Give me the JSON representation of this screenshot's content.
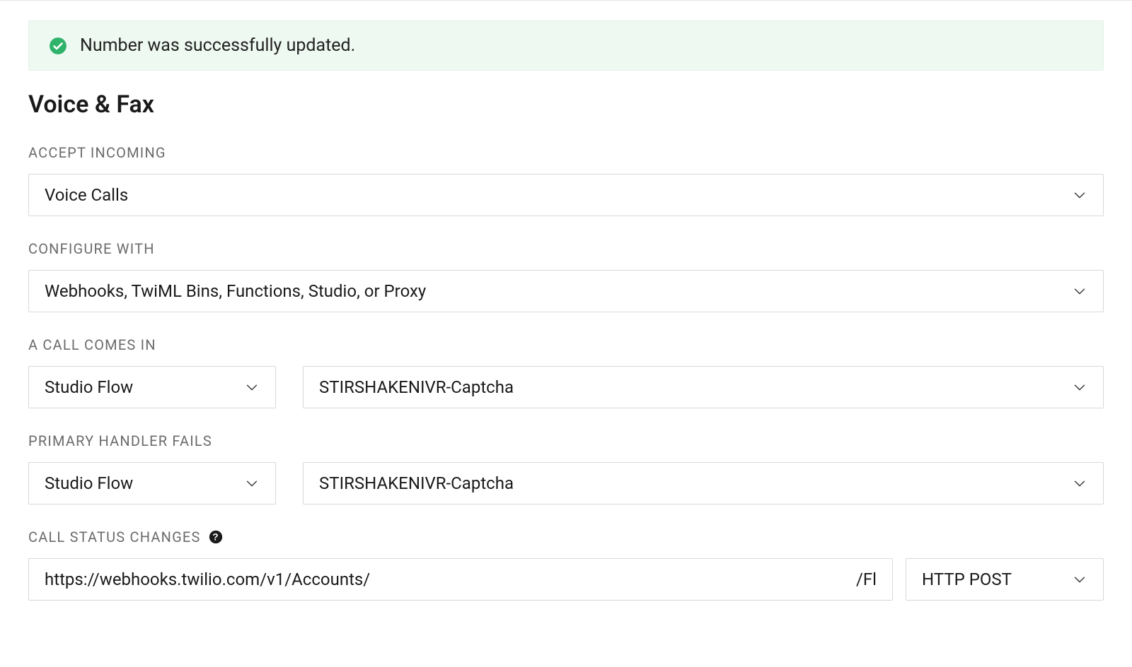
{
  "alert": {
    "message": "Number was successfully updated."
  },
  "section_title": "Voice & Fax",
  "accept_incoming": {
    "label": "ACCEPT INCOMING",
    "value": "Voice Calls"
  },
  "configure_with": {
    "label": "CONFIGURE WITH",
    "value": "Webhooks, TwiML Bins, Functions, Studio, or Proxy"
  },
  "call_comes_in": {
    "label": "A CALL COMES IN",
    "type_value": "Studio Flow",
    "target_value": "STIRSHAKENIVR-Captcha"
  },
  "primary_handler_fails": {
    "label": "PRIMARY HANDLER FAILS",
    "type_value": "Studio Flow",
    "target_value": "STIRSHAKENIVR-Captcha"
  },
  "call_status_changes": {
    "label": "CALL STATUS CHANGES",
    "url_prefix": "https://webhooks.twilio.com/v1/Accounts/",
    "url_suffix": "/Fl",
    "method": "HTTP POST"
  }
}
